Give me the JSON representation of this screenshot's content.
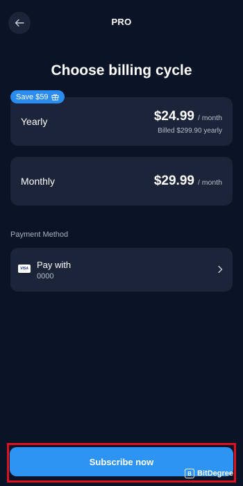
{
  "header": {
    "title": "PRO",
    "back_icon": "arrow-left-icon"
  },
  "page_title": "Choose billing cycle",
  "plans": [
    {
      "name": "Yearly",
      "badge": "Save $59",
      "badge_icon": "gift-icon",
      "price": "$24.99",
      "period": "/ month",
      "note": "Billed $299.90 yearly"
    },
    {
      "name": "Monthly",
      "price": "$29.99",
      "period": "/ month"
    }
  ],
  "payment": {
    "section_label": "Payment Method",
    "card_brand": "VISA",
    "title": "Pay with",
    "number": "0000",
    "chevron_icon": "chevron-right-icon"
  },
  "cta": {
    "label": "Subscribe now"
  },
  "watermark": {
    "text": "BitDegree",
    "logo_letter": "B"
  },
  "colors": {
    "background": "#0b1426",
    "card": "#1b2438",
    "accent": "#2d94f3",
    "badge": "#2b8cf0",
    "highlight_frame": "#e01020"
  }
}
